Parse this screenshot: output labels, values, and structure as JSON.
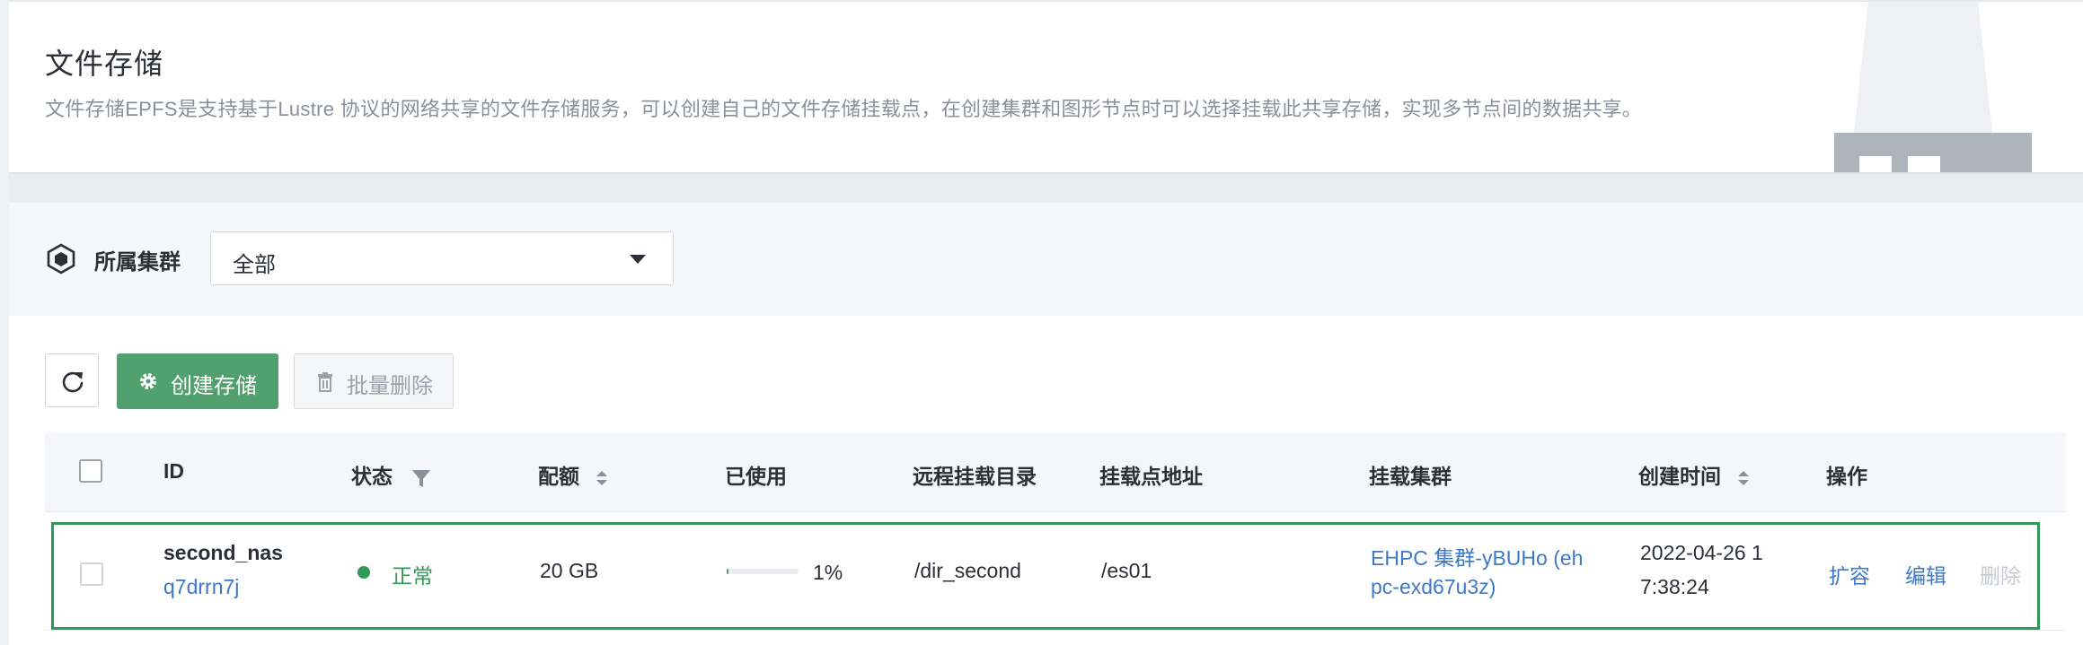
{
  "header": {
    "title": "文件存储",
    "description": "文件存储EPFS是支持基于Lustre 协议的网络共享的文件存储服务，可以创建自己的文件存储挂载点，在创建集群和图形节点时可以选择挂载此共享存储，实现多节点间的数据共享。"
  },
  "filter": {
    "label": "所属集群",
    "selected": "全部"
  },
  "toolbar": {
    "refresh_icon": "refresh-icon",
    "create_label": "创建存储",
    "batch_delete_label": "批量删除"
  },
  "table": {
    "columns": {
      "id": "ID",
      "status": "状态",
      "quota": "配额",
      "used": "已使用",
      "remote_dir": "远程挂载目录",
      "mount_addr": "挂载点地址",
      "cluster": "挂载集群",
      "created": "创建时间",
      "actions": "操作"
    },
    "rows": [
      {
        "name": "second_nas",
        "id": "q7drrn7j",
        "status": "正常",
        "status_color": "#2e9a56",
        "quota": "20 GB",
        "used_pct": 1,
        "used_label": "1%",
        "remote_dir": "/dir_second",
        "mount_addr": "/es01",
        "cluster_line1": "EHPC 集群-yBUHo (eh",
        "cluster_line2": "pc-exd67u3z)",
        "created_line1": "2022-04-26 1",
        "created_line2": "7:38:24",
        "action_expand": "扩容",
        "action_edit": "编辑",
        "action_delete": "删除"
      }
    ]
  },
  "colors": {
    "primary": "#52a06e",
    "link": "#3f78c7",
    "row_highlight": "#2e9a56"
  }
}
